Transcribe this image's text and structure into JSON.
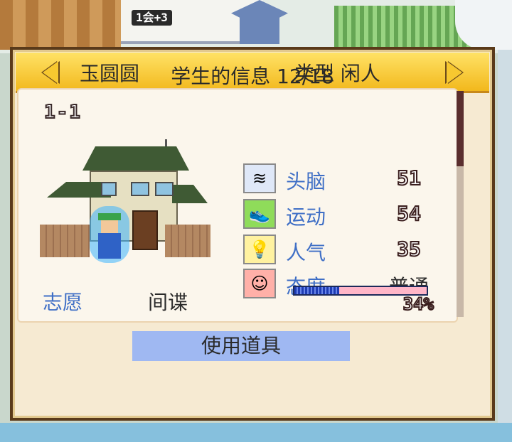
{
  "hud": {
    "population_badge": "1会+3"
  },
  "panel": {
    "title": "学生的信息 12/18",
    "student_name": "玉圆圆",
    "student_type": "类型 闲人",
    "student_id": "1-1",
    "stats": [
      {
        "icon": "brain-icon",
        "label": "头脑",
        "value": "51"
      },
      {
        "icon": "sneaker-icon",
        "label": "运动",
        "value": "54"
      },
      {
        "icon": "lightbulb-icon",
        "label": "人气",
        "value": "35"
      },
      {
        "icon": "smiley-icon",
        "label": "态度",
        "value": "普通"
      }
    ],
    "aspiration_label": "志愿",
    "aspiration_value": "间谍",
    "progress_percent": 34,
    "progress_text": "34%",
    "use_item_label": "使用道具"
  }
}
